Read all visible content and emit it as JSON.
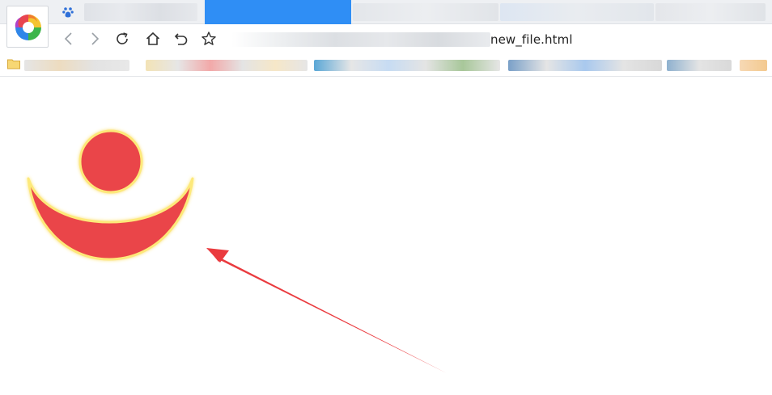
{
  "window": {
    "address_url": "new_file.html",
    "tab_icon": "baidu-paw-icon",
    "app_logo": "rainbow-swirl-logo"
  },
  "toolbar": {
    "icons": [
      "back-icon",
      "forward-icon",
      "reload-icon",
      "home-icon",
      "undo-icon",
      "star-icon"
    ]
  },
  "colors": {
    "tab_active": "#2f8ef5",
    "shape_fill": "#ea454a",
    "shape_glow": "#fde97a",
    "arrow": "#ea3b3f"
  }
}
